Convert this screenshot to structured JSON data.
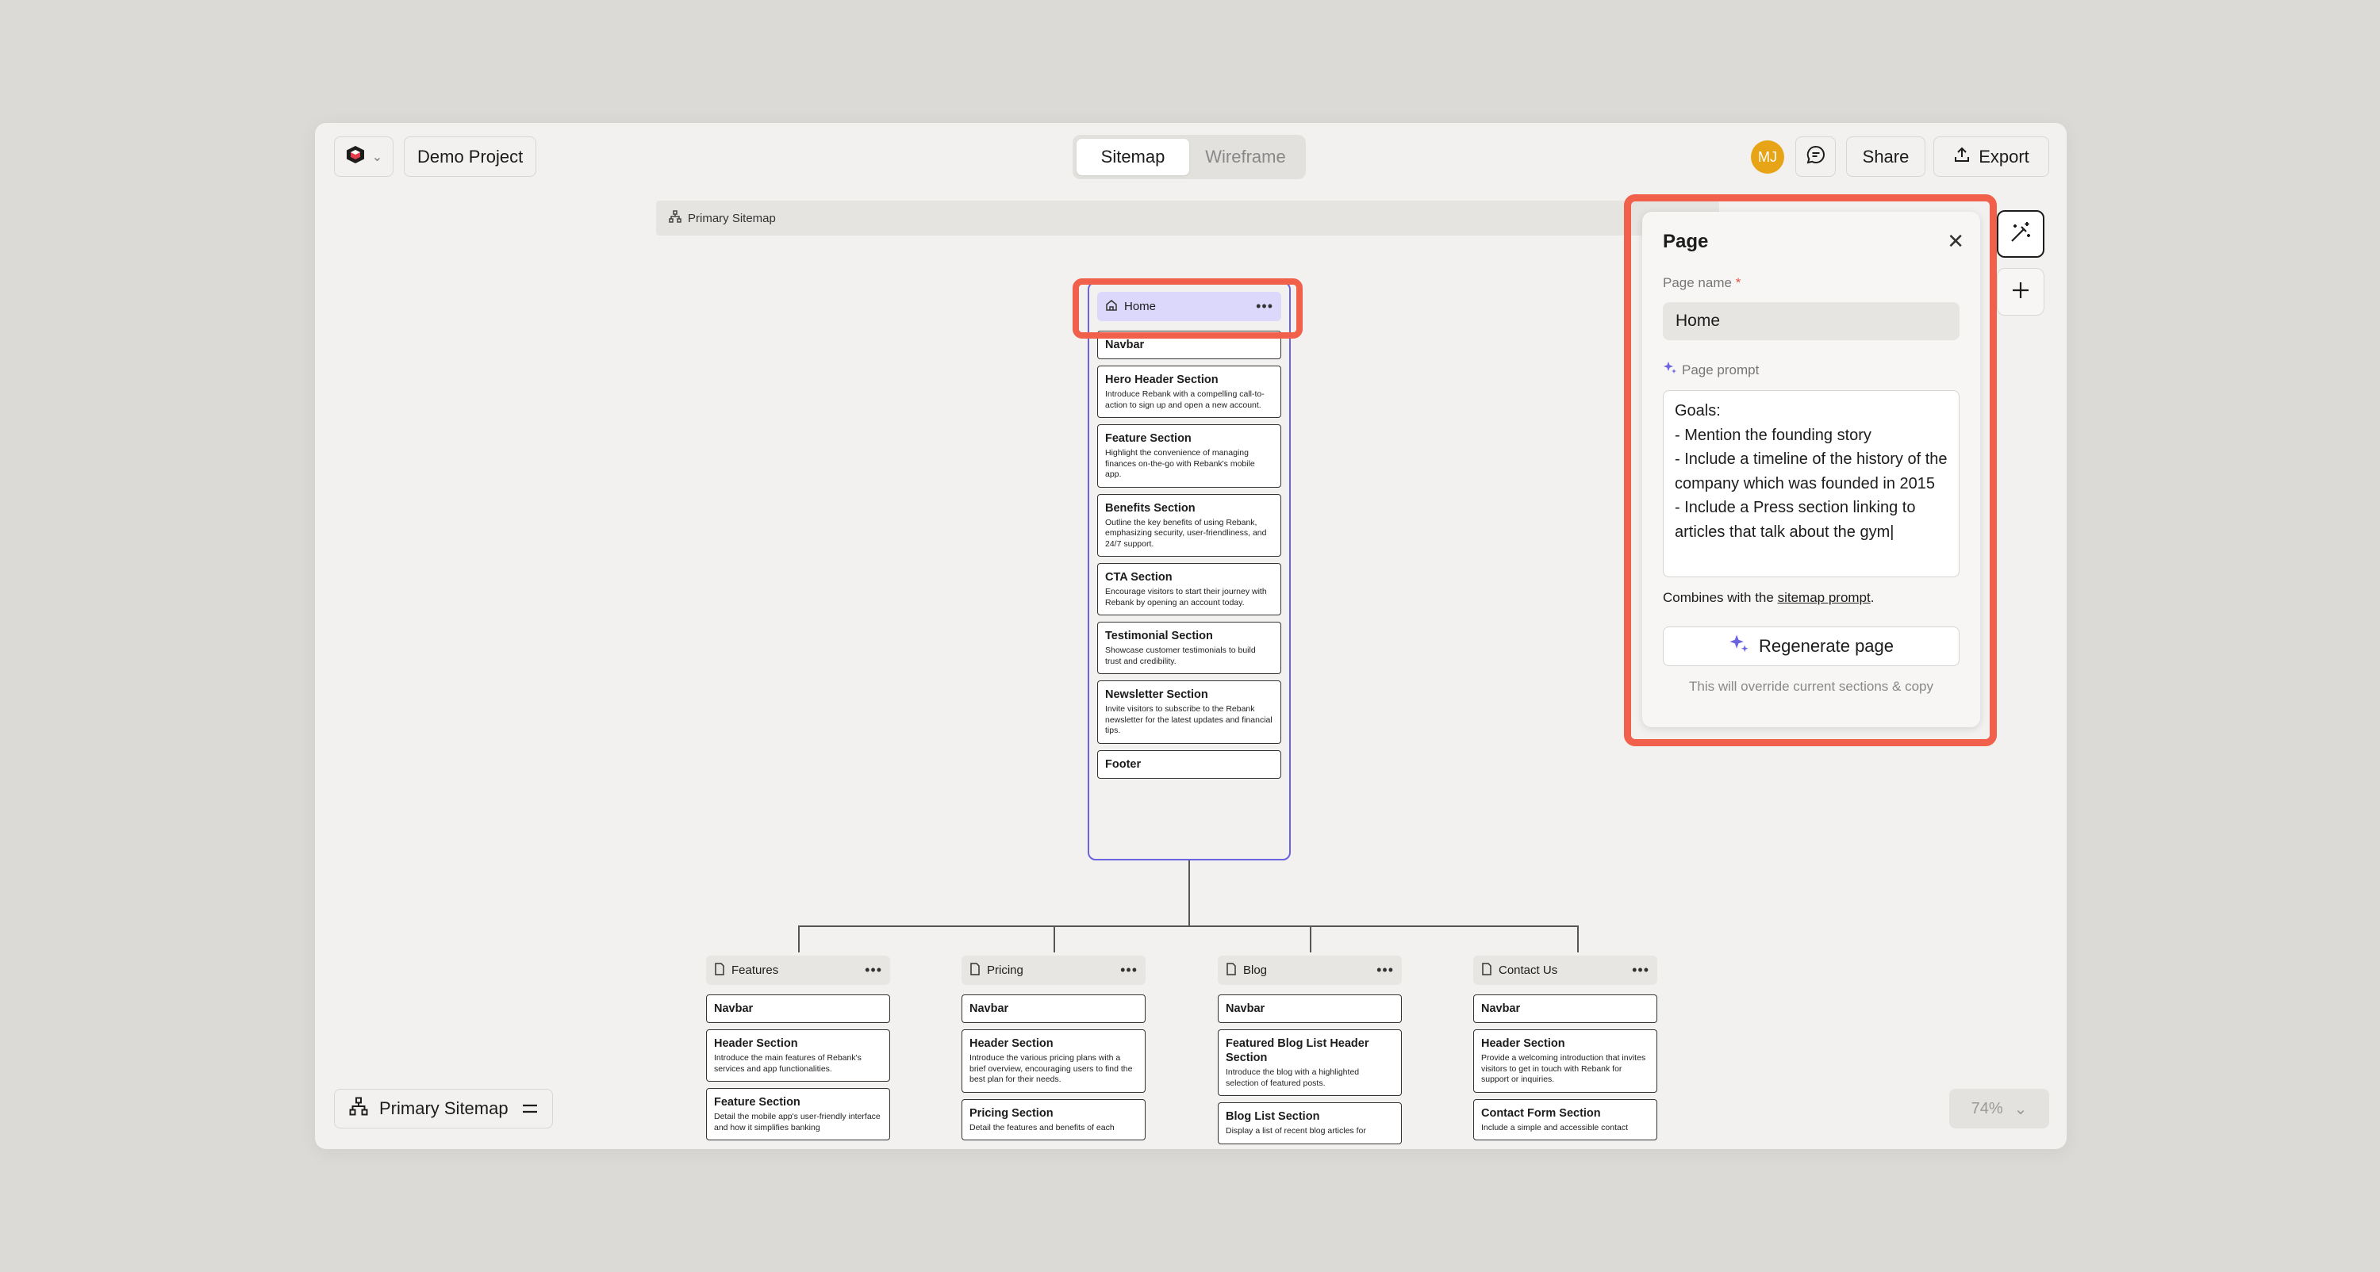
{
  "header": {
    "project_name": "Demo Project",
    "tabs": [
      {
        "label": "Sitemap",
        "active": true
      },
      {
        "label": "Wireframe",
        "active": false
      }
    ],
    "avatar_initials": "MJ",
    "share_label": "Share",
    "export_label": "Export"
  },
  "canvas": {
    "band_label": "Primary Sitemap",
    "home": {
      "title": "Home",
      "sections": [
        {
          "title": "Navbar",
          "desc": ""
        },
        {
          "title": "Hero Header Section",
          "desc": "Introduce Rebank with a compelling call-to-action to sign up and open a new account."
        },
        {
          "title": "Feature Section",
          "desc": "Highlight the convenience of managing finances on-the-go with Rebank's mobile app."
        },
        {
          "title": "Benefits Section",
          "desc": "Outline the key benefits of using Rebank, emphasizing security, user-friendliness, and 24/7 support."
        },
        {
          "title": "CTA Section",
          "desc": "Encourage visitors to start their journey with Rebank by opening an account today."
        },
        {
          "title": "Testimonial Section",
          "desc": "Showcase customer testimonials to build trust and credibility."
        },
        {
          "title": "Newsletter Section",
          "desc": "Invite visitors to subscribe to the Rebank newsletter for the latest updates and financial tips."
        },
        {
          "title": "Footer",
          "desc": ""
        }
      ]
    },
    "children": [
      {
        "title": "Features",
        "sections": [
          {
            "title": "Navbar",
            "desc": ""
          },
          {
            "title": "Header Section",
            "desc": "Introduce the main features of Rebank's services and app functionalities."
          },
          {
            "title": "Feature Section",
            "desc": "Detail the mobile app's user-friendly interface and how it simplifies banking"
          }
        ]
      },
      {
        "title": "Pricing",
        "sections": [
          {
            "title": "Navbar",
            "desc": ""
          },
          {
            "title": "Header Section",
            "desc": "Introduce the various pricing plans with a brief overview, encouraging users to find the best plan for their needs."
          },
          {
            "title": "Pricing Section",
            "desc": "Detail the features and benefits of each"
          }
        ]
      },
      {
        "title": "Blog",
        "sections": [
          {
            "title": "Navbar",
            "desc": ""
          },
          {
            "title": "Featured Blog List Header Section",
            "desc": "Introduce the blog with a highlighted selection of featured posts."
          },
          {
            "title": "Blog List Section",
            "desc": "Display a list of recent blog articles for"
          }
        ]
      },
      {
        "title": "Contact Us",
        "sections": [
          {
            "title": "Navbar",
            "desc": ""
          },
          {
            "title": "Header Section",
            "desc": "Provide a welcoming introduction that invites visitors to get in touch with Rebank for support or inquiries."
          },
          {
            "title": "Contact Form Section",
            "desc": "Include a simple and accessible contact"
          }
        ]
      }
    ]
  },
  "panel": {
    "title": "Page",
    "name_label": "Page name",
    "required_mark": "*",
    "name_value": "Home",
    "prompt_label": "Page prompt",
    "prompt_value": "Goals:\n- Mention the founding story\n- Include a timeline of the history of the company which was founded in 2015\n- Include a Press section linking to articles that talk about the gym|",
    "combines_prefix": "Combines with the ",
    "combines_link": "sitemap prompt",
    "combines_suffix": ".",
    "regenerate_label": "Regenerate page",
    "warning": "This will override current sections & copy"
  },
  "footer": {
    "sitemap_label": "Primary Sitemap",
    "zoom": "74%"
  },
  "colors": {
    "accent_purple": "#6c63e0",
    "highlight_red": "#f0604a",
    "avatar": "#e8a417"
  }
}
